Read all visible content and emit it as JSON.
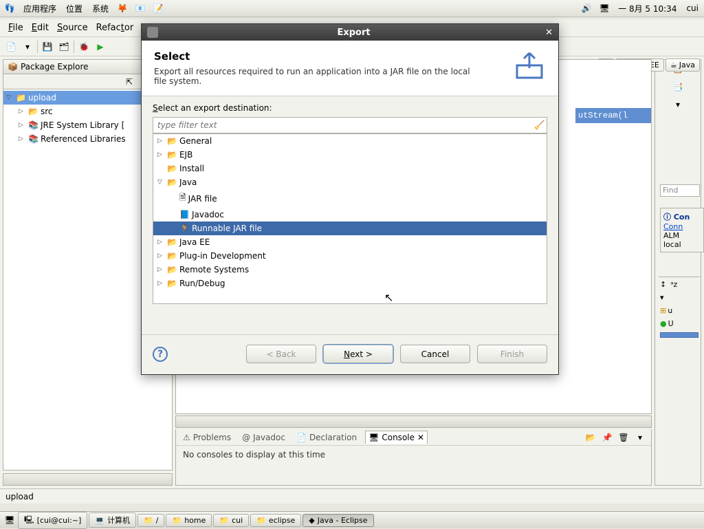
{
  "gnome": {
    "menus": [
      "应用程序",
      "位置",
      "系统"
    ],
    "clock": "一 8月  5 10:34",
    "user": "cui"
  },
  "eclipse": {
    "menu": {
      "file": "File",
      "edit": "Edit",
      "source": "Source",
      "refactor": "Refactor"
    },
    "perspectives": {
      "java_ee": "Java EE",
      "java": "Java"
    },
    "package_explorer": {
      "title": "Package Explore",
      "project": "upload",
      "nodes": {
        "src": "src",
        "jre": "JRE System Library [",
        "ref": "Referenced Libraries"
      }
    },
    "editor_peek": "utStream(l",
    "bottom_tabs": {
      "problems": "Problems",
      "javadoc": "Javadoc",
      "declaration": "Declaration",
      "console": "Console"
    },
    "console_text": "No consoles to display at this time",
    "status": "upload",
    "find_placeholder": "Find",
    "con": {
      "hdr": "Con",
      "link": "Conn",
      "alm": "ALM",
      "local": "local"
    },
    "outline": {
      "u1": "u",
      "u2": "U"
    }
  },
  "dialog": {
    "title": "Export",
    "header": "Select",
    "desc": "Export all resources required to run an application into a JAR file on the local file system.",
    "select_label": "Select an export destination:",
    "filter_placeholder": "type filter text",
    "tree": {
      "general": "General",
      "ejb": "EJB",
      "install": "Install",
      "java": "Java",
      "jar_file": "JAR file",
      "javadoc": "Javadoc",
      "runnable": "Runnable JAR file",
      "java_ee": "Java EE",
      "plugin": "Plug-in Development",
      "remote": "Remote Systems",
      "rundebug": "Run/Debug"
    },
    "buttons": {
      "back": "< Back",
      "next": "Next >",
      "cancel": "Cancel",
      "finish": "Finish"
    }
  },
  "taskbar": {
    "items": [
      "[cui@cui:~]",
      "计算机",
      "/",
      "home",
      "cui",
      "eclipse",
      "Java - Eclipse"
    ]
  }
}
